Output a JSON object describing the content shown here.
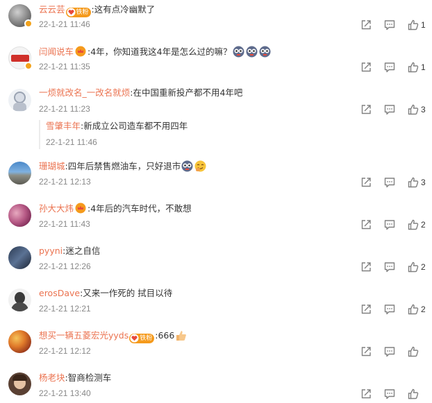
{
  "comments": [
    {
      "user": "云云芸",
      "badge": "铁粉",
      "text": ":这有点冷幽默了",
      "time": "22-1-21 11:46",
      "likes": "1"
    },
    {
      "user": "闫闻说车",
      "text": ":4年，你知道我这4年是怎么过的嘛？",
      "time": "22-1-21 11:35",
      "likes": "1"
    },
    {
      "user": "一烦就改名_一改名就烦",
      "text": ":在中国重新投产都不用4年吧",
      "time": "22-1-21 11:23",
      "likes": "3",
      "reply": {
        "user": "雪肇丰年",
        "text": ":新成立公司造车都不用四年",
        "time": "22-1-21 11:46"
      }
    },
    {
      "user": "珊瑚城",
      "text": ":四年后禁售燃油车，只好退市",
      "time": "22-1-21 12:13",
      "likes": "3"
    },
    {
      "user": "孙大大炜",
      "text": ":4年后的汽车时代，不敢想",
      "time": "22-1-21 11:43",
      "likes": "2"
    },
    {
      "user": "pyyni",
      "text": ":迷之自信",
      "time": "22-1-21 12:26",
      "likes": "2"
    },
    {
      "user": "erosDave",
      "text": ":又来一作死的 拭目以待",
      "time": "22-1-21 12:21",
      "likes": "2"
    },
    {
      "user": "想买一辆五菱宏光yyds",
      "badge": "铁粉",
      "text": ":666",
      "time": "22-1-21 12:12",
      "likes": ""
    },
    {
      "user": "杨老块",
      "text": ":智商检测车",
      "time": "22-1-21 13:40",
      "likes": ""
    }
  ],
  "icons": {
    "share": "share-icon",
    "comment": "comment-icon",
    "like": "like-icon",
    "vip": "vip-badge-icon",
    "heart": "fan-heart-icon"
  },
  "colors": {
    "username": "#eb7350",
    "timestamp": "#888888",
    "text": "#333333",
    "badge": "#f59a1c"
  }
}
